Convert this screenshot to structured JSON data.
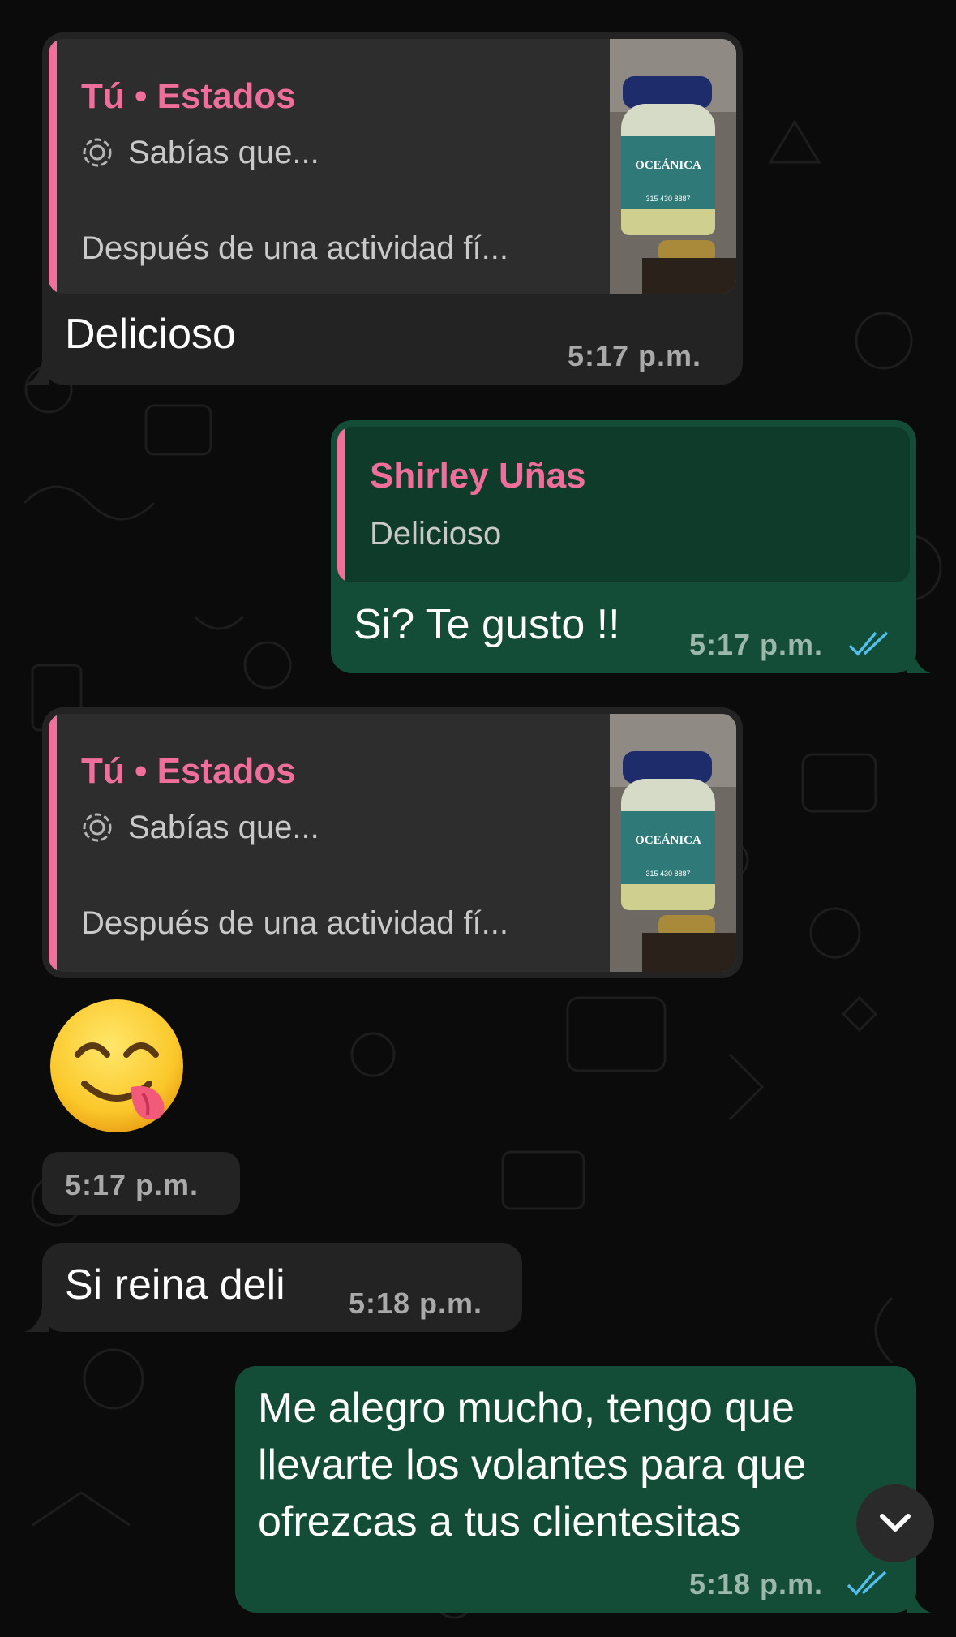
{
  "messages": [
    {
      "direction": "incoming",
      "quote": {
        "author": "Tú • Estados",
        "status_title": "Sabías que...",
        "status_text": "Después de una actividad fí..."
      },
      "text": "Delicioso",
      "time": "5:17 p.m."
    },
    {
      "direction": "outgoing",
      "quote": {
        "author": "Shirley Uñas",
        "text": "Delicioso"
      },
      "text": "Si? Te gusto !!",
      "time": "5:17 p.m.",
      "read": true
    },
    {
      "direction": "incoming",
      "quote": {
        "author": "Tú • Estados",
        "status_title": "Sabías que...",
        "status_text": "Después de una actividad fí..."
      },
      "emoji": "face-savoring-food",
      "time": "5:17 p.m."
    },
    {
      "direction": "incoming",
      "text": "Si reina deli",
      "time": "5:18 p.m."
    },
    {
      "direction": "outgoing",
      "text_lines": [
        "Me alegro mucho, tengo que",
        "llevarte los volantes para que",
        "ofrezcas a tus clientesitas"
      ],
      "time": "5:18 p.m.",
      "read": true
    }
  ],
  "thumbnail": {
    "brand_text": "OCEÁNICA",
    "phone_text": "315 430 8887"
  },
  "scroll_down_icon": "chevron-down-icon",
  "colors": {
    "quote_author": "#f06e9b",
    "read_ticks": "#53bdeb",
    "outgoing_bubble": "#144d37",
    "incoming_bubble": "#232323"
  }
}
